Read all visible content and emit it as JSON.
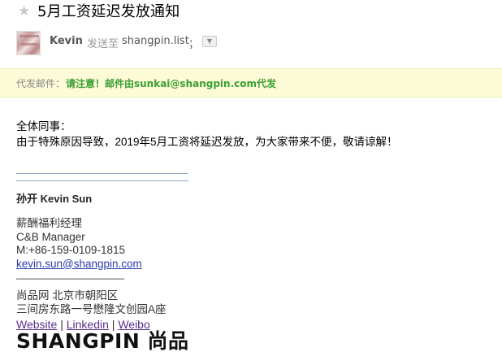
{
  "email": {
    "subject": "5月工资延迟发放通知",
    "sender": {
      "name": "Kevin",
      "sent_to_label": "发送至",
      "recipient": "shangpin.list",
      "recipient_sep": "；"
    },
    "proxy": {
      "label": "代发邮件：",
      "text": "请注意！邮件由sunkai@shangpin.com代发"
    },
    "body": {
      "greeting": "全体同事：",
      "message": "由于特殊原因导致，2019年5月工资将延迟发放，为大家带来不便，敬请谅解！"
    },
    "signature": {
      "name": "孙开 Kevin Sun",
      "title_cn": "薪酬福利经理",
      "title_en": "C&B Manager",
      "mobile": "M:+86-159-0109-1815",
      "email": "kevin.sun@shangpin.com",
      "divider": "————————————",
      "addr_line1": "尚品网 北京市朝阳区",
      "addr_line2": "三间房东路一号懋隆文创园A座",
      "link_website": "Website",
      "link_linkedin": "Linkedin",
      "link_weibo": "Weibo",
      "link_sep": "|",
      "logo_text": "SHANGPIN 尚品"
    }
  },
  "colors": {
    "proxy_bg": "#fdfbd7",
    "proxy_text": "#3a9f33",
    "link": "#1a0dab",
    "visited_link": "#5b2d8e"
  },
  "icons": {
    "star": "star-icon",
    "expand": "chevron-down-icon"
  }
}
